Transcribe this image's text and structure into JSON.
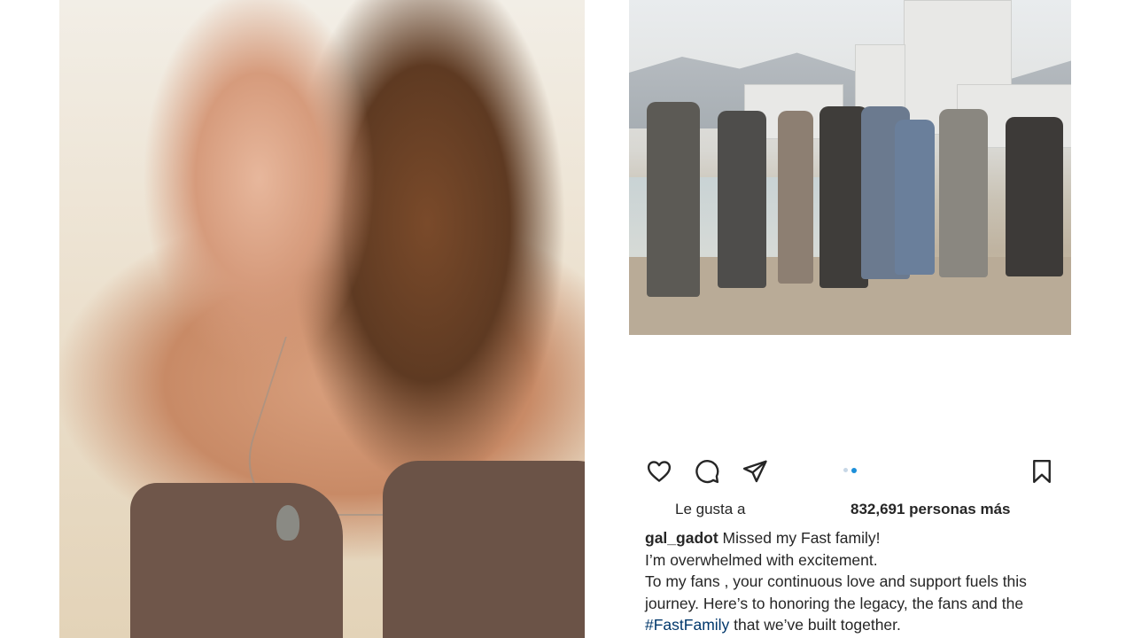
{
  "post": {
    "username": "gal_gadot",
    "caption_lines": [
      "Missed my Fast family!",
      "I’m overwhelmed with excitement.",
      "To my fans , your continuous love and support fuels this",
      "journey. Here’s to honoring the legacy, the fans and the"
    ],
    "hashtag": "#FastFamily",
    "caption_end": " that we’ve built together.",
    "likes_prefix": "Le gusta a",
    "likes_count": "832,691 personas más",
    "carousel": {
      "total": 2,
      "active_index": 1
    }
  },
  "icons": {
    "like": "heart-icon",
    "comment": "comment-icon",
    "share": "send-icon",
    "save": "bookmark-icon"
  },
  "colors": {
    "text": "#262626",
    "hashtag": "#00376b",
    "carousel_active": "#1c8fd9",
    "carousel_inactive": "#c7d7e6"
  }
}
